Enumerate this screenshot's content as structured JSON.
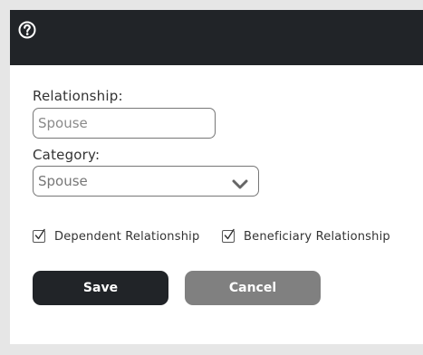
{
  "header": {
    "help_icon": "question-circle-icon",
    "background_color": "#212428"
  },
  "form": {
    "relationship": {
      "label": "Relationship:",
      "value": "",
      "placeholder": "Spouse"
    },
    "category": {
      "label": "Category:",
      "selected": "Spouse",
      "icon": "chevron-down-icon"
    },
    "options": [
      {
        "label": "Dependent Relationship",
        "checked": true
      },
      {
        "label": "Beneficiary Relationship",
        "checked": true
      }
    ]
  },
  "actions": {
    "save_label": "Save",
    "cancel_label": "Cancel",
    "save_color": "#212428",
    "cancel_color": "#808080"
  }
}
